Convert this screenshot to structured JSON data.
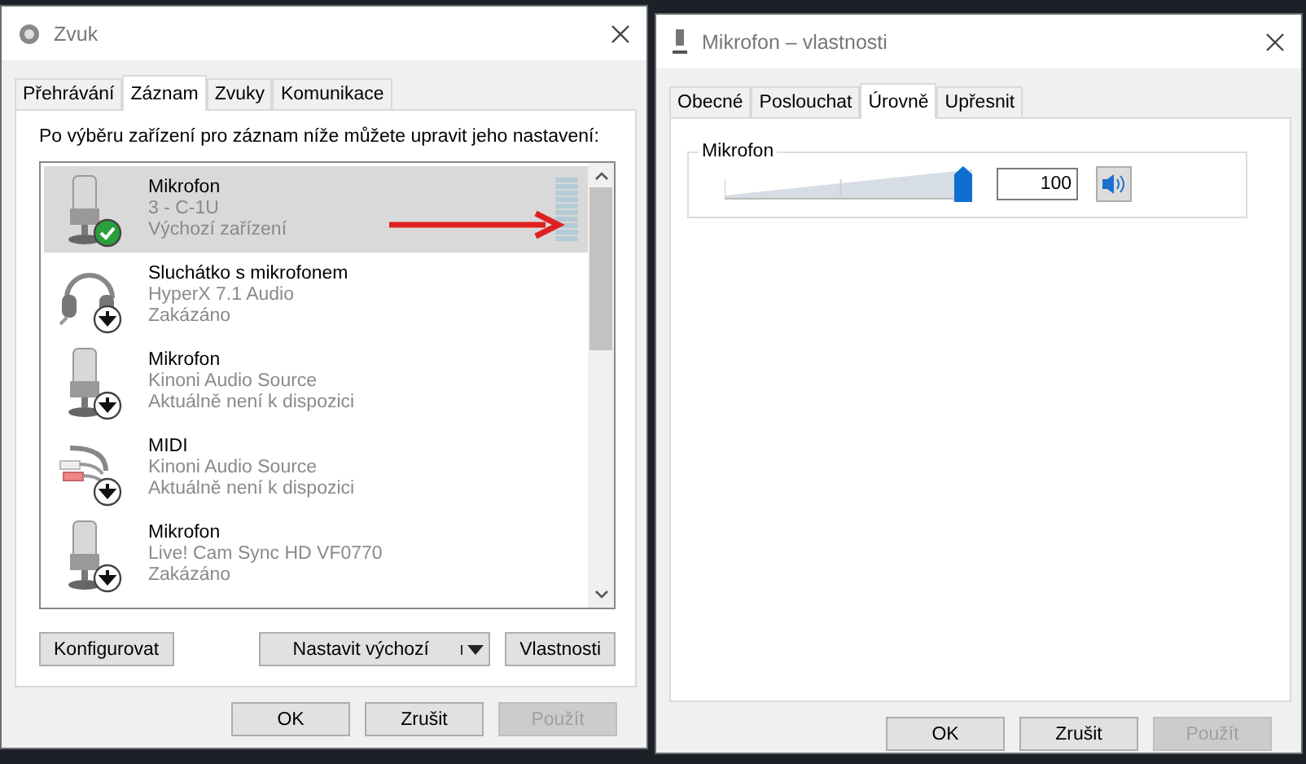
{
  "sound_dialog": {
    "title": "Zvuk",
    "tabs": [
      {
        "label": "Přehrávání",
        "selected": false
      },
      {
        "label": "Záznam",
        "selected": true
      },
      {
        "label": "Zvuky",
        "selected": false
      },
      {
        "label": "Komunikace",
        "selected": false
      }
    ],
    "instruction": "Po výběru zařízení pro záznam níže můžete upravit jeho nastavení:",
    "devices": [
      {
        "name": "Mikrofon",
        "model": "3 - C-1U",
        "status": "Výchozí zařízení",
        "kind": "microphone",
        "default": true,
        "selected": true
      },
      {
        "name": "Sluchátko s mikrofonem",
        "model": "HyperX 7.1 Audio",
        "status": "Zakázáno",
        "kind": "headset",
        "default": false,
        "selected": false
      },
      {
        "name": "Mikrofon",
        "model": "Kinoni Audio Source",
        "status": "Aktuálně není k dispozici",
        "kind": "microphone",
        "default": false,
        "selected": false
      },
      {
        "name": "MIDI",
        "model": "Kinoni Audio Source",
        "status": "Aktuálně není k dispozici",
        "kind": "cable",
        "default": false,
        "selected": false
      },
      {
        "name": "Mikrofon",
        "model": "Live! Cam Sync HD VF0770",
        "status": "Zakázáno",
        "kind": "microphone",
        "default": false,
        "selected": false
      }
    ],
    "configure_button": "Konfigurovat",
    "set_default_button": "Nastavit výchozí",
    "properties_button": "Vlastnosti",
    "footer_buttons": [
      {
        "label": "OK",
        "disabled": false
      },
      {
        "label": "Zrušit",
        "disabled": false
      },
      {
        "label": "Použít",
        "disabled": true
      }
    ]
  },
  "properties_dialog": {
    "title": "Mikrofon – vlastnosti",
    "tabs": [
      {
        "label": "Obecné",
        "selected": false
      },
      {
        "label": "Poslouchat",
        "selected": false
      },
      {
        "label": "Úrovně",
        "selected": true
      },
      {
        "label": "Upřesnit",
        "selected": false
      }
    ],
    "group_label": "Mikrofon",
    "level": 1,
    "value": "100",
    "muted": false,
    "footer_buttons": [
      {
        "label": "OK",
        "disabled": false
      },
      {
        "label": "Zrušit",
        "disabled": false
      },
      {
        "label": "Použít",
        "disabled": true
      }
    ]
  }
}
